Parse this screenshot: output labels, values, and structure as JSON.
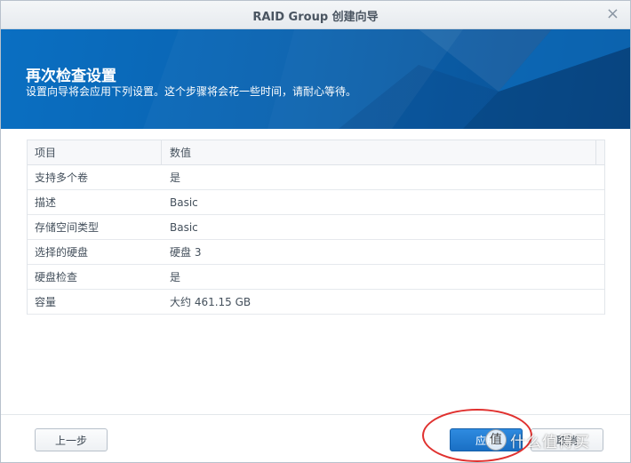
{
  "window": {
    "title": "RAID Group 创建向导",
    "close_symbol": "×"
  },
  "banner": {
    "heading": "再次检查设置",
    "subheading": "设置向导将会应用下列设置。这个步骤将会花一些时间，请耐心等待。",
    "color": "#0a63b0"
  },
  "table": {
    "headers": {
      "item": "项目",
      "value": "数值"
    },
    "rows": [
      {
        "item": "支持多个卷",
        "value": "是"
      },
      {
        "item": "描述",
        "value": "Basic"
      },
      {
        "item": "存储空间类型",
        "value": "Basic"
      },
      {
        "item": "选择的硬盘",
        "value": "硬盘 3"
      },
      {
        "item": "硬盘检查",
        "value": "是"
      },
      {
        "item": "容量",
        "value": "大约 461.15 GB"
      }
    ]
  },
  "footer": {
    "prev_label": "上一步",
    "apply_label": "应用",
    "cancel_label": "取消"
  },
  "watermark": {
    "logo": "值",
    "text": "什么值得买"
  },
  "colors": {
    "accent": "#1a6fc4",
    "highlight_ring": "#e0312f"
  }
}
